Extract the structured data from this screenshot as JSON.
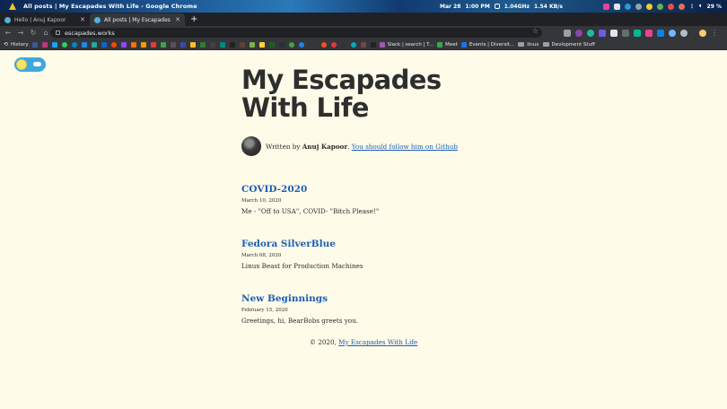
{
  "os_panel": {
    "window_title": "All posts | My Escapades With Life - Google Chrome",
    "date": "Mar 28",
    "time": "1:00 PM",
    "cpu": "1.04GHz",
    "net": "1.54 KB/s",
    "battery": "29 %"
  },
  "tabs": [
    {
      "label": "Hello | Anuj Kapoor",
      "active": false,
      "favicon_color": "#4fb3d9"
    },
    {
      "label": "All posts | My Escapades Wi...",
      "active": true,
      "favicon_color": "#4fb3d9"
    }
  ],
  "address_bar": {
    "url": "escapades.works"
  },
  "bookmarks": {
    "history_label": "History",
    "items": [
      {
        "label": "Slack | search | T...",
        "icon": "slack-icon",
        "color": "#9b59b6"
      },
      {
        "label": "Meet",
        "icon": "meet-icon",
        "color": "#34a853"
      },
      {
        "label": "Events | Diversit...",
        "icon": "events-icon",
        "color": "#1a73e8"
      },
      {
        "label": "linux",
        "icon": "folder-icon",
        "color": "#9aa0a6"
      },
      {
        "label": "Devlopment Stuff",
        "icon": "folder-icon",
        "color": "#9aa0a6"
      }
    ]
  },
  "blog": {
    "title_line1": "My Escapades",
    "title_line2": "With Life",
    "author_prefix": "Written by ",
    "author_name": "Anuj Kapoor",
    "author_suffix": ". ",
    "github_link": "You should follow him on Github"
  },
  "posts": [
    {
      "title": "COVID-2020",
      "date": "March 10, 2020",
      "desc": "Me - \"Off to USA\", COVID- \"Bitch Please!\""
    },
    {
      "title": "Fedora SilverBlue",
      "date": "March 08, 2020",
      "desc": "Linux Beast for Production Machines"
    },
    {
      "title": "New Beginnings",
      "date": "February 15, 2020",
      "desc": "Greetings, hi, BearBobs greets you."
    }
  ],
  "footer": {
    "prefix": "© 2020, ",
    "link": "My Escapades With Life"
  },
  "colors": {
    "background": "#fefbe9",
    "link": "#1d5fb4",
    "text": "#2e2e2e",
    "toggle": "#3fa7e0"
  }
}
